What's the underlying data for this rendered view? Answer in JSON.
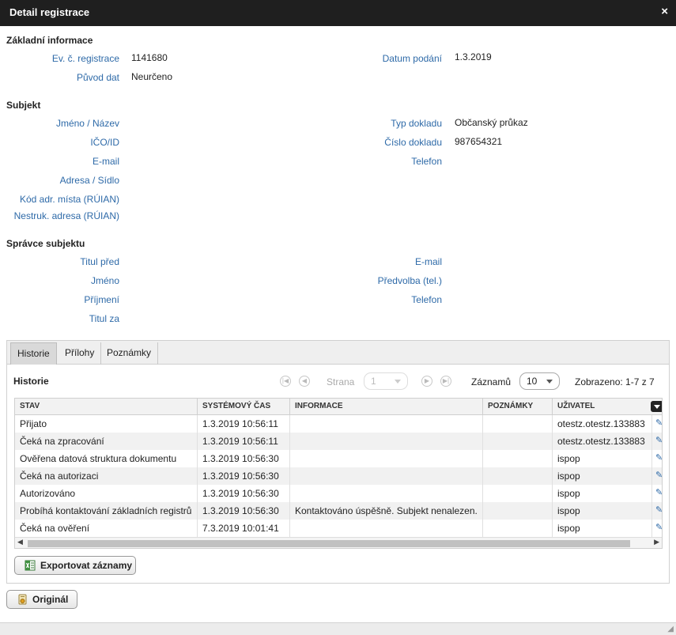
{
  "window": {
    "title": "Detail registrace",
    "close_label": "×"
  },
  "basic": {
    "title": "Základní informace",
    "reg_label": "Ev. č. registrace",
    "reg_value": "1141680",
    "date_label": "Datum podání",
    "date_value": "1.3.2019",
    "origin_label": "Původ dat",
    "origin_value": "Neurčeno"
  },
  "subject": {
    "title": "Subjekt",
    "name_label": "Jméno / Název",
    "doctype_label": "Typ dokladu",
    "doctype_value": "Občanský průkaz",
    "ico_label": "IČO/ID",
    "docnum_label": "Číslo dokladu",
    "docnum_value": "987654321",
    "email_label": "E-mail",
    "phone_label": "Telefon",
    "address_label": "Adresa / Sídlo",
    "ruian_label": "Kód adr. místa (RÚIAN)",
    "unstruct_label": "Nestruk. adresa (RÚIAN)"
  },
  "admin": {
    "title": "Správce subjektu",
    "title_before_label": "Titul před",
    "email_label": "E-mail",
    "first_name_label": "Jméno",
    "prefix_label": "Předvolba (tel.)",
    "surname_label": "Příjmení",
    "phone_label": "Telefon",
    "title_after_label": "Titul za"
  },
  "tabs": {
    "history": "Historie",
    "attachments": "Přílohy",
    "notes": "Poznámky"
  },
  "history": {
    "title": "Historie",
    "page_label": "Strana",
    "page_value": "1",
    "records_label": "Záznamů",
    "records_value": "10",
    "shown": "Zobrazeno: 1-7 z 7",
    "columns": [
      "STAV",
      "SYSTÉMOVÝ ČAS",
      "INFORMACE",
      "POZNÁMKY",
      "UŽIVATEL"
    ],
    "rows": [
      {
        "stav": "Přijato",
        "cas": "1.3.2019 10:56:11",
        "info": "",
        "pozn": "",
        "user": "otestz.otestz.133883"
      },
      {
        "stav": "Čeká na zpracování",
        "cas": "1.3.2019 10:56:11",
        "info": "",
        "pozn": "",
        "user": "otestz.otestz.133883"
      },
      {
        "stav": "Ověřena datová struktura dokumentu",
        "cas": "1.3.2019 10:56:30",
        "info": "",
        "pozn": "",
        "user": "ispop"
      },
      {
        "stav": "Čeká na autorizaci",
        "cas": "1.3.2019 10:56:30",
        "info": "",
        "pozn": "",
        "user": "ispop"
      },
      {
        "stav": "Autorizováno",
        "cas": "1.3.2019 10:56:30",
        "info": "",
        "pozn": "",
        "user": "ispop"
      },
      {
        "stav": "Probíhá kontaktování základních registrů",
        "cas": "1.3.2019 10:56:30",
        "info": "Kontaktováno úspěšně. Subjekt nenalezen.",
        "pozn": "",
        "user": "ispop"
      },
      {
        "stav": "Čeká na ověření",
        "cas": "7.3.2019 10:01:41",
        "info": "",
        "pozn": "",
        "user": "ispop"
      }
    ]
  },
  "buttons": {
    "export": "Exportovat záznamy",
    "original": "Originál"
  }
}
